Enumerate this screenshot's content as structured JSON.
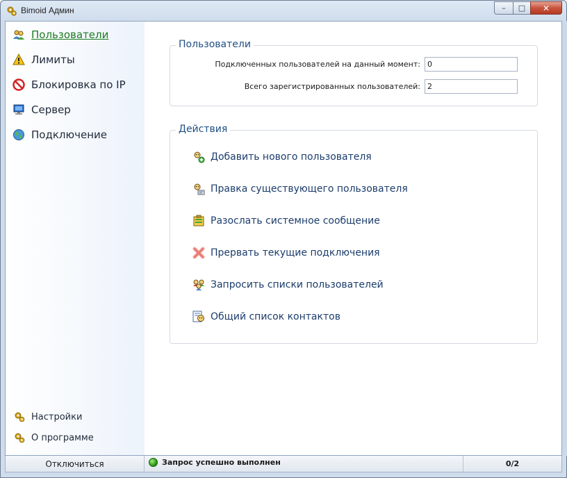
{
  "window": {
    "title": "Bimoid Админ",
    "close_glyph": "✕",
    "min_glyph": "–",
    "max_glyph": "□"
  },
  "sidebar": {
    "items": [
      {
        "label": "Пользователи",
        "icon": "users-icon",
        "active": true
      },
      {
        "label": "Лимиты",
        "icon": "warning-icon"
      },
      {
        "label": "Блокировка по IP",
        "icon": "block-icon"
      },
      {
        "label": "Сервер",
        "icon": "monitor-icon"
      },
      {
        "label": "Подключение",
        "icon": "globe-icon"
      }
    ],
    "bottom": [
      {
        "label": "Настройки",
        "icon": "gears-icon"
      },
      {
        "label": "О программе",
        "icon": "gears-icon"
      }
    ]
  },
  "users_group": {
    "title": "Пользователи",
    "connected_label": "Подключенных пользователей на данный момент:",
    "connected_value": "0",
    "registered_label": "Всего зарегистрированных пользователей:",
    "registered_value": "2"
  },
  "actions_group": {
    "title": "Действия",
    "items": [
      {
        "label": "Добавить нового пользователя",
        "icon": "add-user-icon"
      },
      {
        "label": "Правка существующего пользователя",
        "icon": "edit-user-icon"
      },
      {
        "label": "Разослать системное сообщение",
        "icon": "broadcast-icon"
      },
      {
        "label": "Прервать текущие подключения",
        "icon": "disconnect-icon"
      },
      {
        "label": "Запросить списки пользователей",
        "icon": "user-lists-icon"
      },
      {
        "label": "Общий список контактов",
        "icon": "contacts-icon"
      }
    ]
  },
  "statusbar": {
    "disconnect_label": "Отключиться",
    "status_text": "Запрос успешно выполнен",
    "count": "0/2"
  },
  "colors": {
    "active_nav": "#1d7a24",
    "group_title": "#1f4e84",
    "action_text": "#1b3c6b"
  }
}
